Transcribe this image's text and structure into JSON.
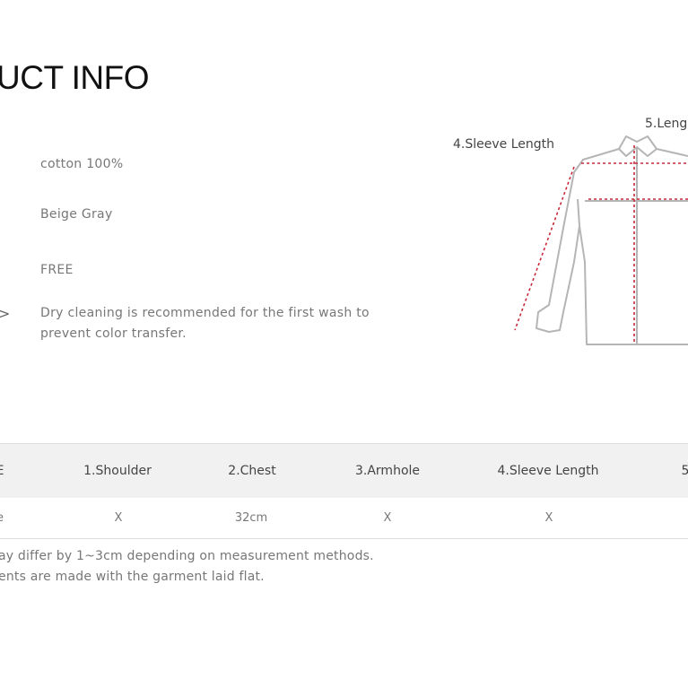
{
  "header": {
    "title": "UCT INFO"
  },
  "info": {
    "material": "cotton 100%",
    "color": "Beige Gray",
    "size": "FREE",
    "care_line1": "Dry cleaning is recommended for the first wash to",
    "care_line2": "prevent color transfer.",
    "care_arrow": ">"
  },
  "diagram": {
    "sleeve_label": "4.Sleeve Length",
    "length_label": "5.Leng",
    "measure_color": "#c8283a",
    "outline_color": "#b5b5b5"
  },
  "size_table": {
    "headers": [
      "E",
      "1.Shoulder",
      "2.Chest",
      "3.Armhole",
      "4.Sleeve Length",
      "5"
    ],
    "row": [
      "e",
      "X",
      "32cm",
      "X",
      "X",
      ""
    ]
  },
  "notes": {
    "line1": "ay differ by 1~3cm depending on measurement methods.",
    "line2": "ents are made with the garment laid flat."
  }
}
